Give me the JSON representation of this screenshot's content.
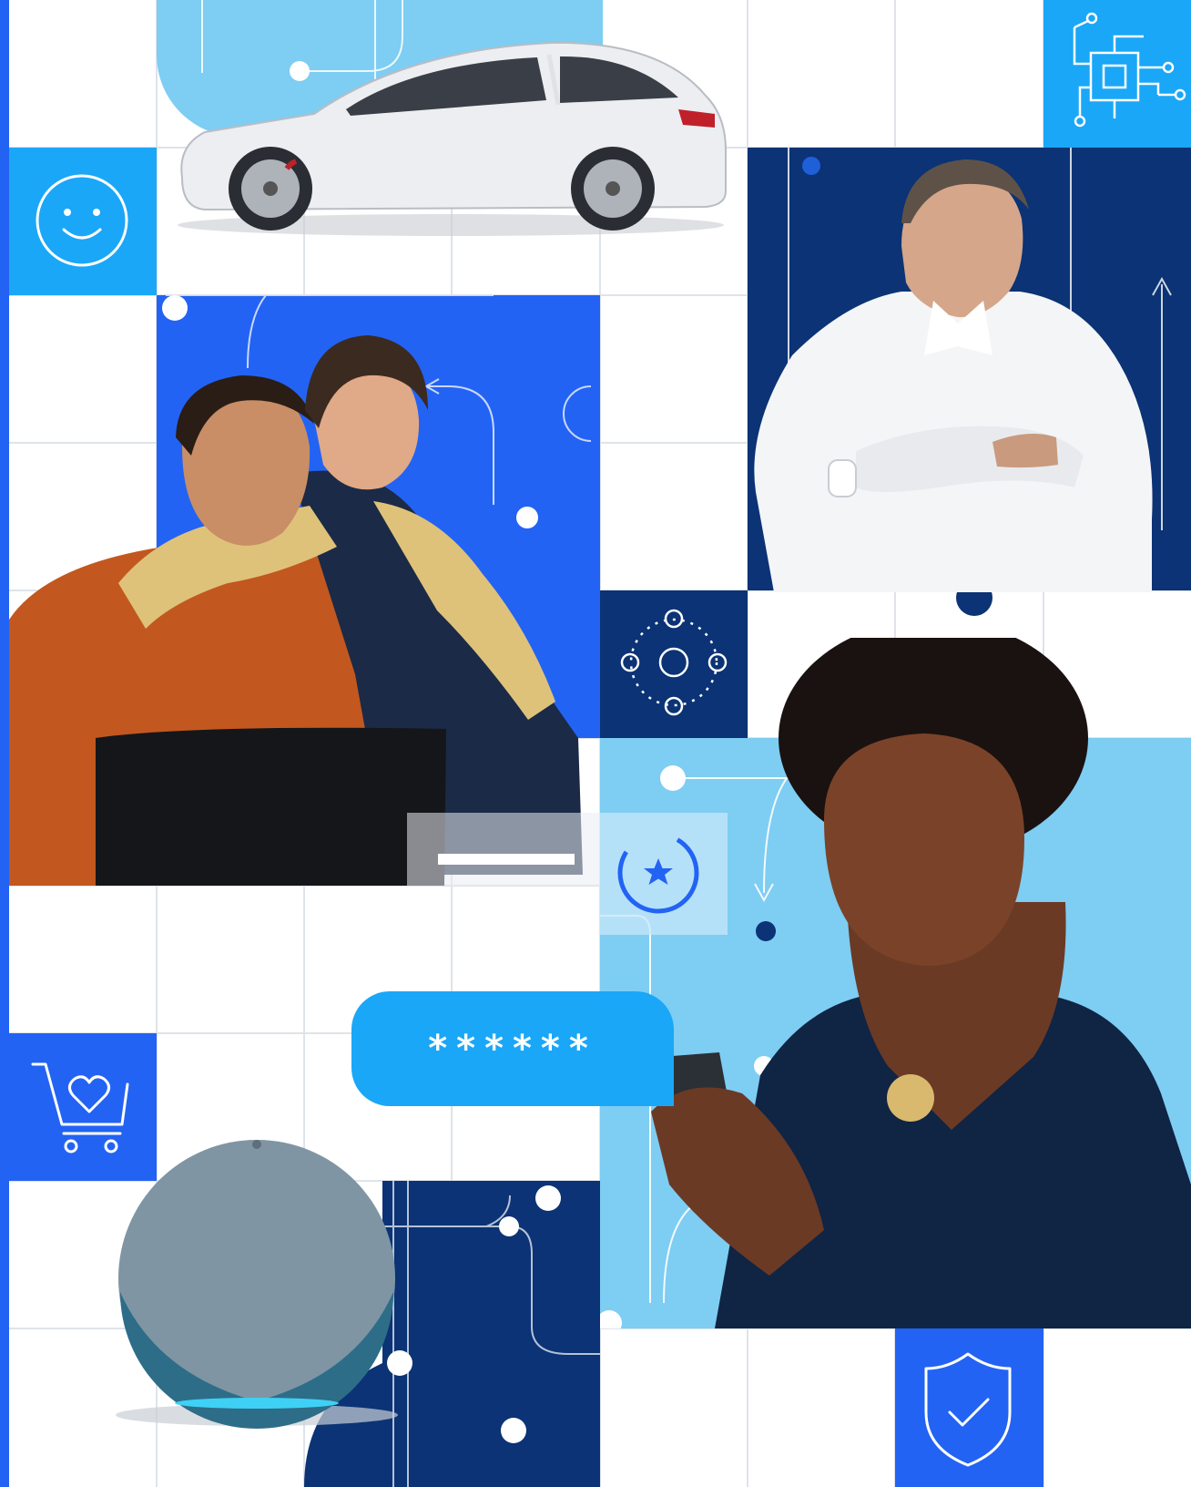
{
  "password_field": {
    "masked_value": "******"
  },
  "palette": {
    "light_blue": "#7ecdf3",
    "sky_blue": "#1aa7f7",
    "royal_blue": "#2363f4",
    "navy": "#0b3375",
    "grid_line": "#dfe3ea"
  },
  "icons": [
    "smiley-face-icon",
    "circuit-chip-icon",
    "orbit-icon",
    "rating-star-icon",
    "shopping-cart-heart-icon",
    "shield-check-icon"
  ],
  "photos": [
    "electric-car",
    "man-and-daughter-with-laptop",
    "man-checking-smartwatch",
    "woman-with-smartphone",
    "smart-speaker"
  ]
}
